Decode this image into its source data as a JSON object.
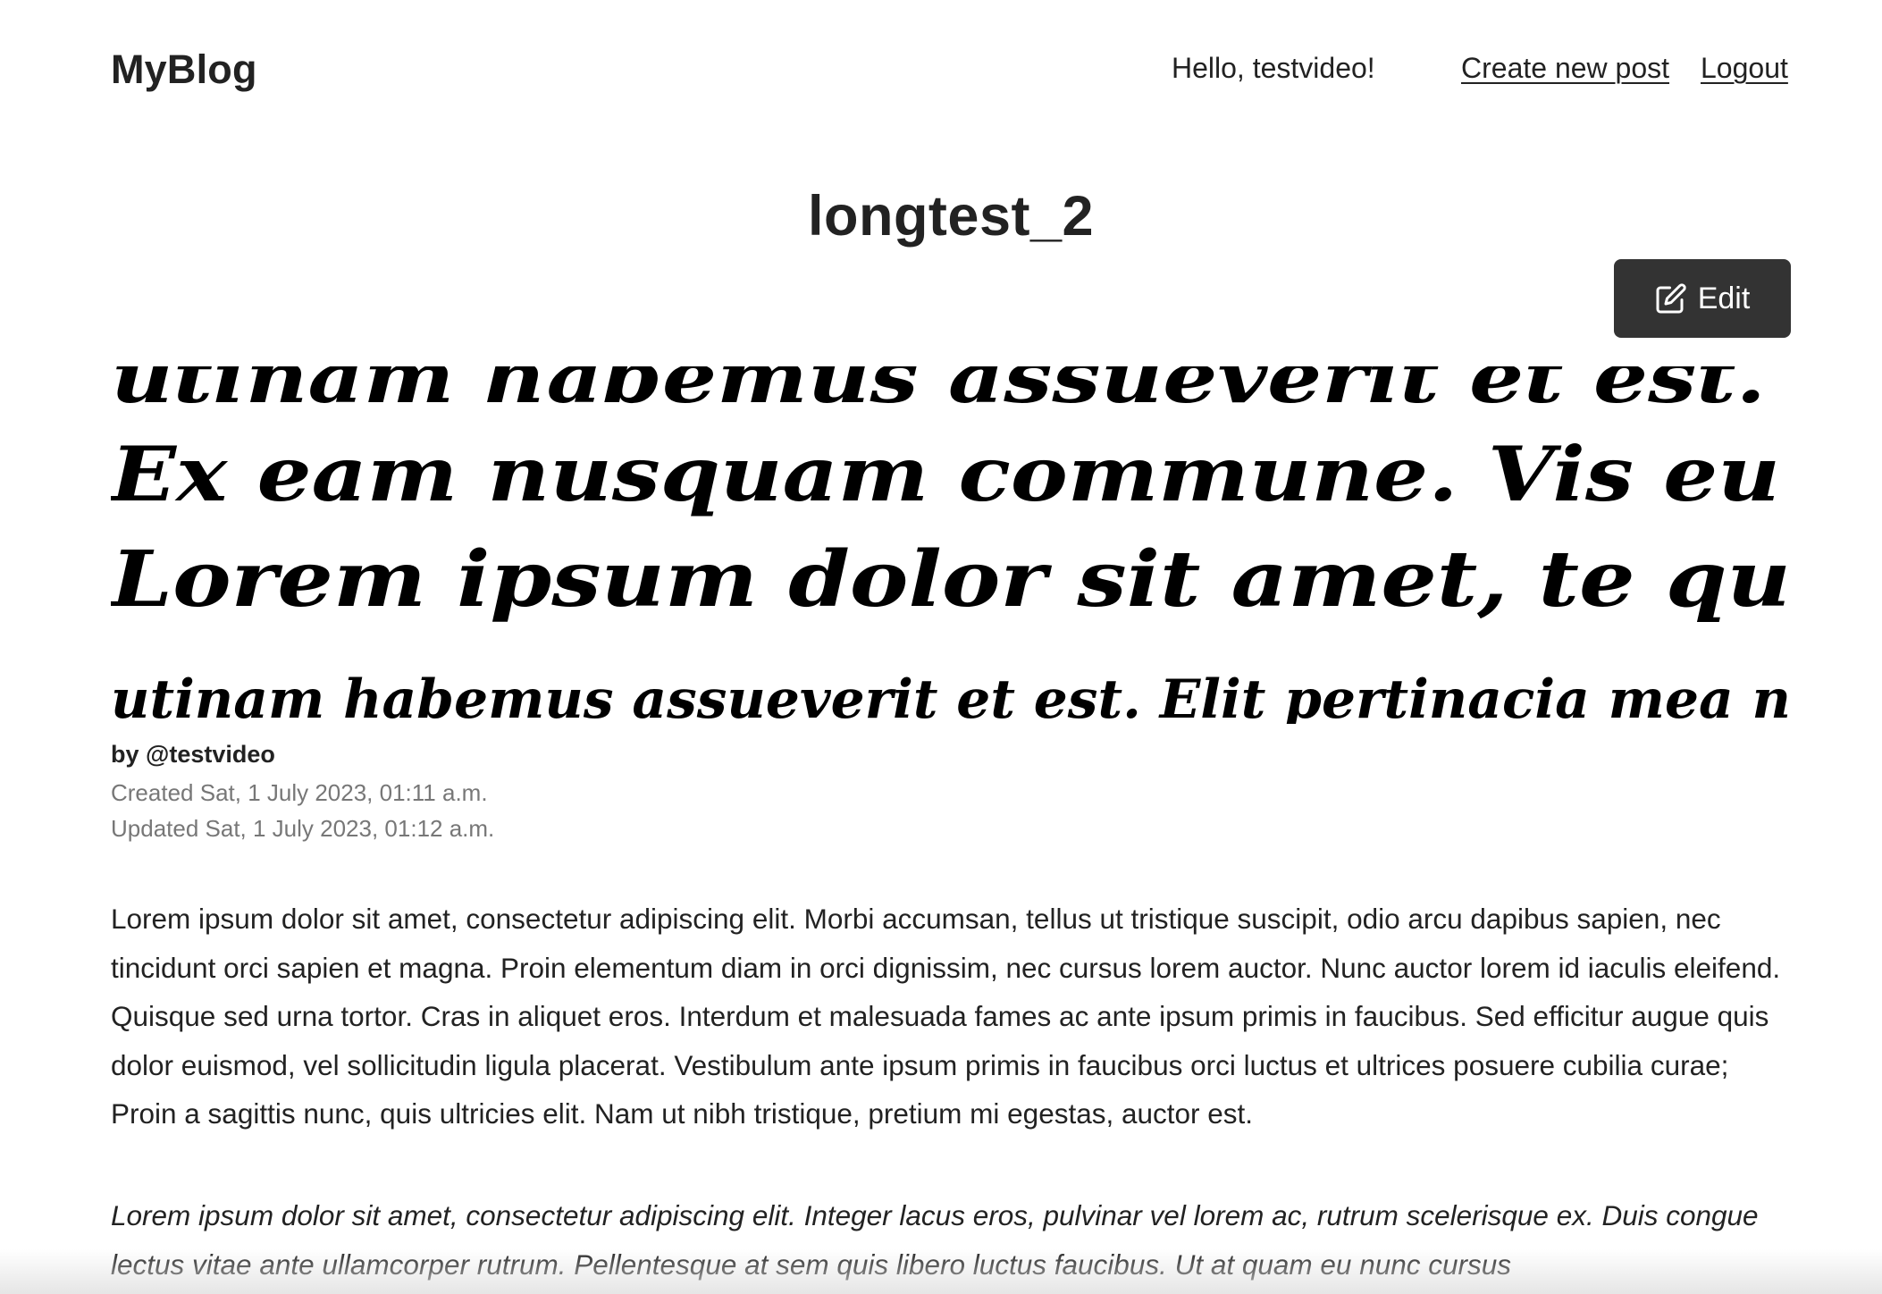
{
  "header": {
    "logo": "MyBlog",
    "greeting": "Hello, testvideo!",
    "create_link": "Create new post",
    "logout_link": "Logout"
  },
  "post": {
    "title": "longtest_2",
    "edit_label": "Edit",
    "image_lines": [
      "utinam habemus assueverit et est.",
      "Ex eam nusquam commune. Vis eu",
      "Lorem ipsum dolor sit amet, te qu",
      "utinam habemus assueverit et est. Elit pertinacia mea n"
    ],
    "author": "by @testvideo",
    "created": "Created Sat, 1 July 2023, 01:11 a.m.",
    "updated": "Updated Sat, 1 July 2023, 01:12 a.m.",
    "paragraphs": [
      "Lorem ipsum dolor sit amet, consectetur adipiscing elit. Morbi accumsan, tellus ut tristique suscipit, odio arcu dapibus sapien, nec tincidunt orci sapien et magna. Proin elementum diam in orci dignissim, nec cursus lorem auctor. Nunc auctor lorem id iaculis eleifend. Quisque sed urna tortor. Cras in aliquet eros. Interdum et malesuada fames ac ante ipsum primis in faucibus. Sed efficitur augue quis dolor euismod, vel sollicitudin ligula placerat. Vestibulum ante ipsum primis in faucibus orci luctus et ultrices posuere cubilia curae; Proin a sagittis nunc, quis ultricies elit. Nam ut nibh tristique, pretium mi egestas, auctor est.",
      "Lorem ipsum dolor sit amet, consectetur adipiscing elit. Integer lacus eros, pulvinar vel lorem ac, rutrum scelerisque ex. Duis congue lectus vitae ante ullamcorper rutrum. Pellentesque at sem quis libero luctus faucibus. Ut at quam eu nunc cursus"
    ]
  },
  "icons": {
    "edit": "pencil-square-icon"
  },
  "colors": {
    "text": "#222222",
    "muted": "#777777",
    "button_bg": "#333333",
    "button_text": "#ffffff"
  }
}
